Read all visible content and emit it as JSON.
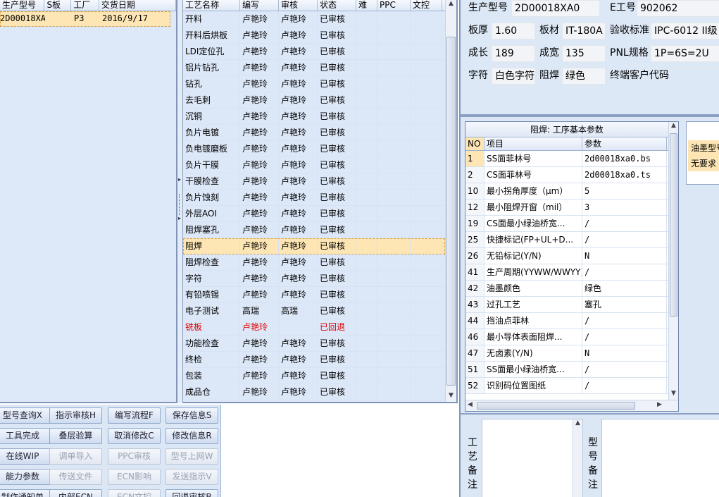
{
  "left_grid": {
    "headers": [
      "生产型号",
      "S板",
      "工厂",
      "交货日期"
    ],
    "rows": [
      [
        "2D00018XA0",
        "",
        "P3",
        "2016/9/17"
      ]
    ]
  },
  "process_grid": {
    "headers": [
      "工艺名称",
      "编写",
      "审核",
      "状态",
      "难",
      "PPC",
      "文控"
    ],
    "rows": [
      {
        "name": "开料",
        "writer": "卢艳玲",
        "reviewer": "卢艳玲",
        "status": "已审核"
      },
      {
        "name": "开料后烘板",
        "writer": "卢艳玲",
        "reviewer": "卢艳玲",
        "status": "已审核"
      },
      {
        "name": "LDI定位孔",
        "writer": "卢艳玲",
        "reviewer": "卢艳玲",
        "status": "已审核"
      },
      {
        "name": "铝片钻孔",
        "writer": "卢艳玲",
        "reviewer": "卢艳玲",
        "status": "已审核"
      },
      {
        "name": "钻孔",
        "writer": "卢艳玲",
        "reviewer": "卢艳玲",
        "status": "已审核"
      },
      {
        "name": "去毛刺",
        "writer": "卢艳玲",
        "reviewer": "卢艳玲",
        "status": "已审核"
      },
      {
        "name": "沉铜",
        "writer": "卢艳玲",
        "reviewer": "卢艳玲",
        "status": "已审核"
      },
      {
        "name": "负片电镀",
        "writer": "卢艳玲",
        "reviewer": "卢艳玲",
        "status": "已审核"
      },
      {
        "name": "负电镀磨板",
        "writer": "卢艳玲",
        "reviewer": "卢艳玲",
        "status": "已审核"
      },
      {
        "name": "负片干膜",
        "writer": "卢艳玲",
        "reviewer": "卢艳玲",
        "status": "已审核"
      },
      {
        "name": "干膜检查",
        "writer": "卢艳玲",
        "reviewer": "卢艳玲",
        "status": "已审核"
      },
      {
        "name": "负片蚀刻",
        "writer": "卢艳玲",
        "reviewer": "卢艳玲",
        "status": "已审核"
      },
      {
        "name": "外层AOI",
        "writer": "卢艳玲",
        "reviewer": "卢艳玲",
        "status": "已审核"
      },
      {
        "name": "阻焊塞孔",
        "writer": "卢艳玲",
        "reviewer": "卢艳玲",
        "status": "已审核"
      },
      {
        "name": "阻焊",
        "writer": "卢艳玲",
        "reviewer": "卢艳玲",
        "status": "已审核"
      },
      {
        "name": "阻焊检查",
        "writer": "卢艳玲",
        "reviewer": "卢艳玲",
        "status": "已审核"
      },
      {
        "name": "字符",
        "writer": "卢艳玲",
        "reviewer": "卢艳玲",
        "status": "已审核"
      },
      {
        "name": "有铅喷锡",
        "writer": "卢艳玲",
        "reviewer": "卢艳玲",
        "status": "已审核"
      },
      {
        "name": "电子测试",
        "writer": "高瑞",
        "reviewer": "高瑞",
        "status": "已审核"
      },
      {
        "name": "铣板",
        "writer": "卢艳玲",
        "reviewer": "",
        "status": "已回退"
      },
      {
        "name": "功能检查",
        "writer": "卢艳玲",
        "reviewer": "卢艳玲",
        "status": "已审核"
      },
      {
        "name": "终检",
        "writer": "卢艳玲",
        "reviewer": "卢艳玲",
        "status": "已审核"
      },
      {
        "name": "包装",
        "writer": "卢艳玲",
        "reviewer": "卢艳玲",
        "status": "已审核"
      },
      {
        "name": "成品仓",
        "writer": "卢艳玲",
        "reviewer": "卢艳玲",
        "status": "已审核"
      }
    ]
  },
  "buttons": [
    {
      "label": "型号查询X",
      "enabled": true
    },
    {
      "label": "指示审核H",
      "enabled": true
    },
    {
      "label": "编写流程F",
      "enabled": true
    },
    {
      "label": "保存信息S",
      "enabled": true
    },
    {
      "label": "工具完成",
      "enabled": true
    },
    {
      "label": "叠层验算",
      "enabled": true
    },
    {
      "label": "取消修改C",
      "enabled": true
    },
    {
      "label": "修改信息R",
      "enabled": true
    },
    {
      "label": "在线WIP",
      "enabled": true
    },
    {
      "label": "调单导入",
      "enabled": false
    },
    {
      "label": "PPC审核",
      "enabled": false
    },
    {
      "label": "型号上网W",
      "enabled": false
    },
    {
      "label": "能力参数",
      "enabled": true
    },
    {
      "label": "传送文件",
      "enabled": false
    },
    {
      "label": "ECN影响",
      "enabled": false
    },
    {
      "label": "发送指示V",
      "enabled": false
    },
    {
      "label": "制作通知单",
      "enabled": true
    },
    {
      "label": "内部ECN",
      "enabled": true
    },
    {
      "label": "ECN文控",
      "enabled": false
    },
    {
      "label": "回退审核B",
      "enabled": true
    }
  ],
  "info": {
    "model_label": "生产型号",
    "model_value": "2D00018XA0",
    "eno_label": "E工号",
    "eno_value": "902062",
    "thickness_label": "板厚",
    "thickness_value": "1.60",
    "material_label": "板材",
    "material_value": "IT-180A",
    "standard_label": "验收标准",
    "standard_value": "IPC-6012 II级",
    "length_label": "成长",
    "length_value": "189",
    "width_label": "成宽",
    "width_value": "135",
    "pnl_label": "PNL规格",
    "pnl_value": "1P=6S=2U",
    "char_label": "字符",
    "char_value": "白色字符",
    "mask_label": "阻焊",
    "mask_value": "绿色",
    "customer_code_label": "终端客户代码",
    "customer_code_value": ""
  },
  "params": {
    "title": "阻焊: 工序基本参数",
    "headers": [
      "NO",
      "项目",
      "参数"
    ],
    "rows": [
      {
        "no": "1",
        "item": "SS面菲林号",
        "value": "2d00018xa0.bs"
      },
      {
        "no": "2",
        "item": "CS面菲林号",
        "value": "2d00018xa0.ts"
      },
      {
        "no": "10",
        "item": "最小拐角厚度（μm）",
        "value": "5"
      },
      {
        "no": "12",
        "item": "最小阻焊开窗（mil）",
        "value": "3"
      },
      {
        "no": "19",
        "item": "CS面最小绿油桥宽...",
        "value": "/"
      },
      {
        "no": "25",
        "item": "快捷标记(FP+UL+D...",
        "value": "/"
      },
      {
        "no": "26",
        "item": "无铅标记(Y/N)",
        "value": "N"
      },
      {
        "no": "41",
        "item": "生产周期(YYWW/WWYY)",
        "value": "/"
      },
      {
        "no": "42",
        "item": "油墨颜色",
        "value": "绿色"
      },
      {
        "no": "43",
        "item": "过孔工艺",
        "value": "塞孔"
      },
      {
        "no": "44",
        "item": "挡油点菲林",
        "value": "/"
      },
      {
        "no": "46",
        "item": "最小导体表面阻焊...",
        "value": "/"
      },
      {
        "no": "47",
        "item": "无卤素(Y/N)",
        "value": "N"
      },
      {
        "no": "51",
        "item": "SS面最小绿油桥宽...",
        "value": "/"
      },
      {
        "no": "52",
        "item": "识别码位置图纸",
        "value": "/"
      }
    ]
  },
  "ink": {
    "header": "油墨型号",
    "value": "无要求"
  },
  "notes": {
    "process_label": "工艺备注",
    "model_label": "型号备注"
  }
}
